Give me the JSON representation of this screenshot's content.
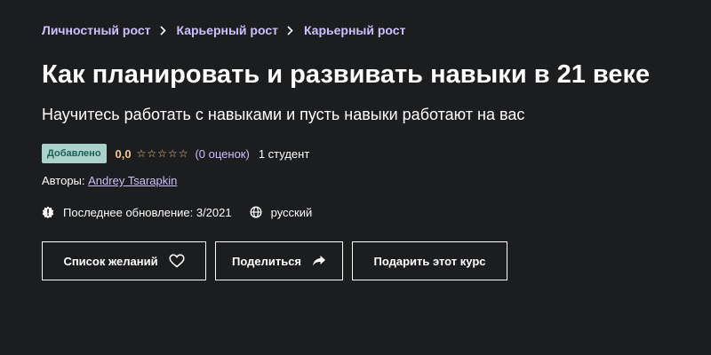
{
  "breadcrumb": {
    "items": [
      "Личностный рост",
      "Карьерный рост",
      "Карьерный рост"
    ]
  },
  "course": {
    "title": "Как планировать и развивать навыки в 21 веке",
    "subtitle": "Научитесь работать с навыками и пусть навыки работают на вас",
    "badge": "Добавлено",
    "rating": "0,0",
    "stars_filled": 0,
    "stars_total": 5,
    "rating_count": "(0 оценок)",
    "students": "1 студент",
    "authors_label": "Авторы:",
    "author_name": "Andrey Tsarapkin",
    "last_updated": "Последнее обновление: 3/2021",
    "language": "русский"
  },
  "buttons": {
    "wishlist": "Список желаний",
    "share": "Поделиться",
    "gift": "Подарить этот курс"
  },
  "icons": {
    "breadcrumb_separator": "chevron-right-icon",
    "update": "alert-badge-icon",
    "language": "globe-icon",
    "wishlist": "heart-icon",
    "share": "share-arrow-icon",
    "star": "star-outline-icon"
  },
  "colors": {
    "background": "#1c1d1f",
    "link": "#cec0fc",
    "rating": "#f3ca8c",
    "badge_bg": "#acd2cc",
    "badge_text": "#1e6055"
  }
}
